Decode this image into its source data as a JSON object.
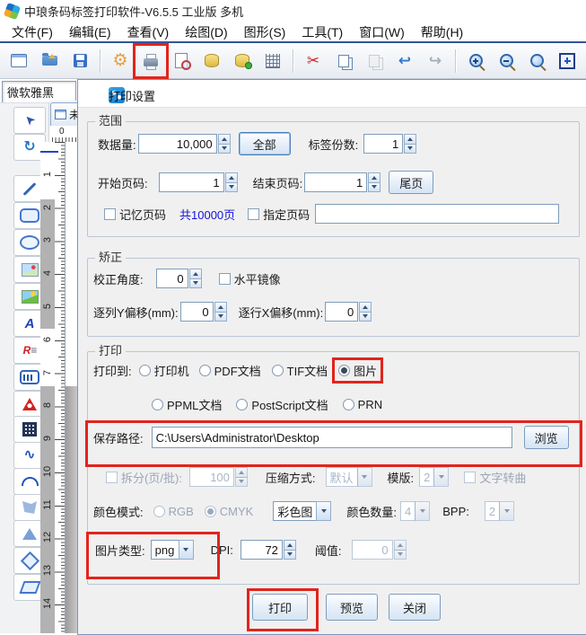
{
  "window": {
    "title": "中琅条码标签打印软件-V6.5.5 工业版 多机"
  },
  "menu": {
    "items": [
      "文件(F)",
      "编辑(E)",
      "查看(V)",
      "绘图(D)",
      "图形(S)",
      "工具(T)",
      "窗口(W)",
      "帮助(H)"
    ]
  },
  "toolbar": {
    "icons": [
      "new-document",
      "open-file",
      "save",
      "settings",
      "print",
      "print-preview",
      "database",
      "database-check",
      "grid",
      "cut",
      "copy",
      "paste",
      "undo",
      "redo",
      "zoom-in",
      "zoom-out",
      "zoom",
      "fit-page",
      "fit-window",
      "group-objects"
    ]
  },
  "editor": {
    "font_selector_value": "微软雅黑",
    "tab_label": "未命名",
    "ruler_origin": "0",
    "ruler_numbers": [
      "1",
      "2",
      "3",
      "4",
      "5",
      "6",
      "7",
      "8",
      "9",
      "10",
      "11",
      "12",
      "13",
      "14"
    ],
    "toolbox_tools": [
      "select",
      "rotate",
      "line",
      "rounded-rect",
      "ellipse",
      "insert-image",
      "insert-picture",
      "text",
      "rich-text",
      "barcode",
      "shape-warning",
      "qr-code",
      "curve",
      "arc",
      "polygon",
      "triangle",
      "diamond",
      "parallelogram"
    ]
  },
  "dialog": {
    "title": "打印设置",
    "range": {
      "title": "范围",
      "data_volume_label": "数据量:",
      "data_volume": "10,000",
      "all_button": "全部",
      "label_copies_label": "标签份数:",
      "label_copies": "1",
      "start_page_label": "开始页码:",
      "start_page": "1",
      "end_page_label": "结束页码:",
      "end_page": "1",
      "last_page_button": "尾页",
      "remember_page": "记忆页码",
      "total_pages": "共10000页",
      "specify_page": "指定页码",
      "specify_page_value": ""
    },
    "correction": {
      "title": "矫正",
      "angle_label": "校正角度:",
      "angle": "0",
      "mirror": "水平镜像",
      "y_offset_label": "逐列Y偏移(mm):",
      "y_offset": "0",
      "x_offset_label": "逐行X偏移(mm):",
      "x_offset": "0"
    },
    "print": {
      "title": "打印",
      "print_to_label": "打印到:",
      "target_printer": "打印机",
      "target_pdf": "PDF文档",
      "target_tif": "TIF文档",
      "target_image": "图片",
      "target_ppml": "PPML文档",
      "target_postscript": "PostScript文档",
      "target_prn": "PRN",
      "selected_target": "图片",
      "save_path_label": "保存路径:",
      "save_path": "C:\\Users\\Administrator\\Desktop",
      "browse_button": "浏览",
      "split_label": "拆分(页/批):",
      "split_value": "100",
      "compression_label": "压缩方式:",
      "compression_value": "默认",
      "template_label": "模版:",
      "template_value": "2",
      "text_to_curve": "文字转曲",
      "color_mode_label": "颜色模式:",
      "rgb": "RGB",
      "cmyk": "CMYK",
      "color_style_value": "彩色图",
      "color_count_label": "颜色数量:",
      "color_count_value": "4",
      "bpp_label": "BPP:",
      "bpp_value": "2",
      "image_type_label": "图片类型:",
      "image_type_value": "png",
      "dpi_label": "DPI:",
      "dpi_value": "72",
      "threshold_label": "阈值:",
      "threshold_value": "0"
    },
    "buttons": {
      "print": "打印",
      "preview": "预览",
      "close": "关闭"
    }
  },
  "annotations": {
    "highlight_color": "#e2241c"
  }
}
